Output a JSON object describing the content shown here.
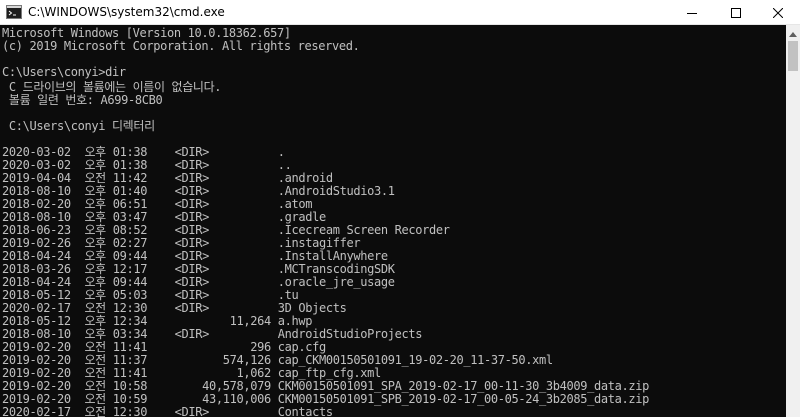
{
  "window": {
    "title": "C:\\WINDOWS\\system32\\cmd.exe",
    "app_icon": "cmd-icon",
    "controls": {
      "minimize": "minimize-icon",
      "maximize": "maximize-icon",
      "close": "close-icon"
    }
  },
  "console": {
    "lines": [
      "Microsoft Windows [Version 10.0.18362.657]",
      "(c) 2019 Microsoft Corporation. All rights reserved.",
      "",
      "C:\\Users\\conyi>dir",
      " C 드라이브의 볼륨에는 이름이 없습니다.",
      " 볼륨 일련 번호: A699-8CB0",
      "",
      " C:\\Users\\conyi 디렉터리",
      "",
      "2020-03-02  오후 01:38    <DIR>          .",
      "2020-03-02  오후 01:38    <DIR>          ..",
      "2019-04-04  오전 11:42    <DIR>          .android",
      "2018-08-10  오후 01:40    <DIR>          .AndroidStudio3.1",
      "2018-02-20  오후 06:51    <DIR>          .atom",
      "2018-08-10  오후 03:47    <DIR>          .gradle",
      "2018-06-23  오후 08:52    <DIR>          .Icecream Screen Recorder",
      "2019-02-26  오후 02:27    <DIR>          .instagiffer",
      "2018-04-24  오후 09:44    <DIR>          .InstallAnywhere",
      "2018-03-26  오후 12:17    <DIR>          .MCTranscodingSDK",
      "2018-04-24  오후 09:44    <DIR>          .oracle_jre_usage",
      "2018-05-12  오후 05:03    <DIR>          .tu",
      "2020-02-17  오전 12:30    <DIR>          3D Objects",
      "2018-05-12  오후 12:34            11,264 a.hwp",
      "2018-08-10  오후 03:34    <DIR>          AndroidStudioProjects",
      "2019-02-20  오전 11:41               296 cap.cfg",
      "2019-02-20  오전 11:37           574,126 cap_CKM00150501091_19-02-20_11-37-50.xml",
      "2019-02-20  오전 11:41             1,062 cap_ftp_cfg.xml",
      "2019-02-20  오전 10:58        40,578,079 CKM00150501091_SPA_2019-02-17_00-11-30_3b4009_data.zip",
      "2019-02-20  오전 10:59        43,110,006 CKM00150501091_SPB_2019-02-17_00-05-24_3b2085_data.zip",
      "2020-02-17  오전 12:30    <DIR>          Contacts"
    ]
  }
}
